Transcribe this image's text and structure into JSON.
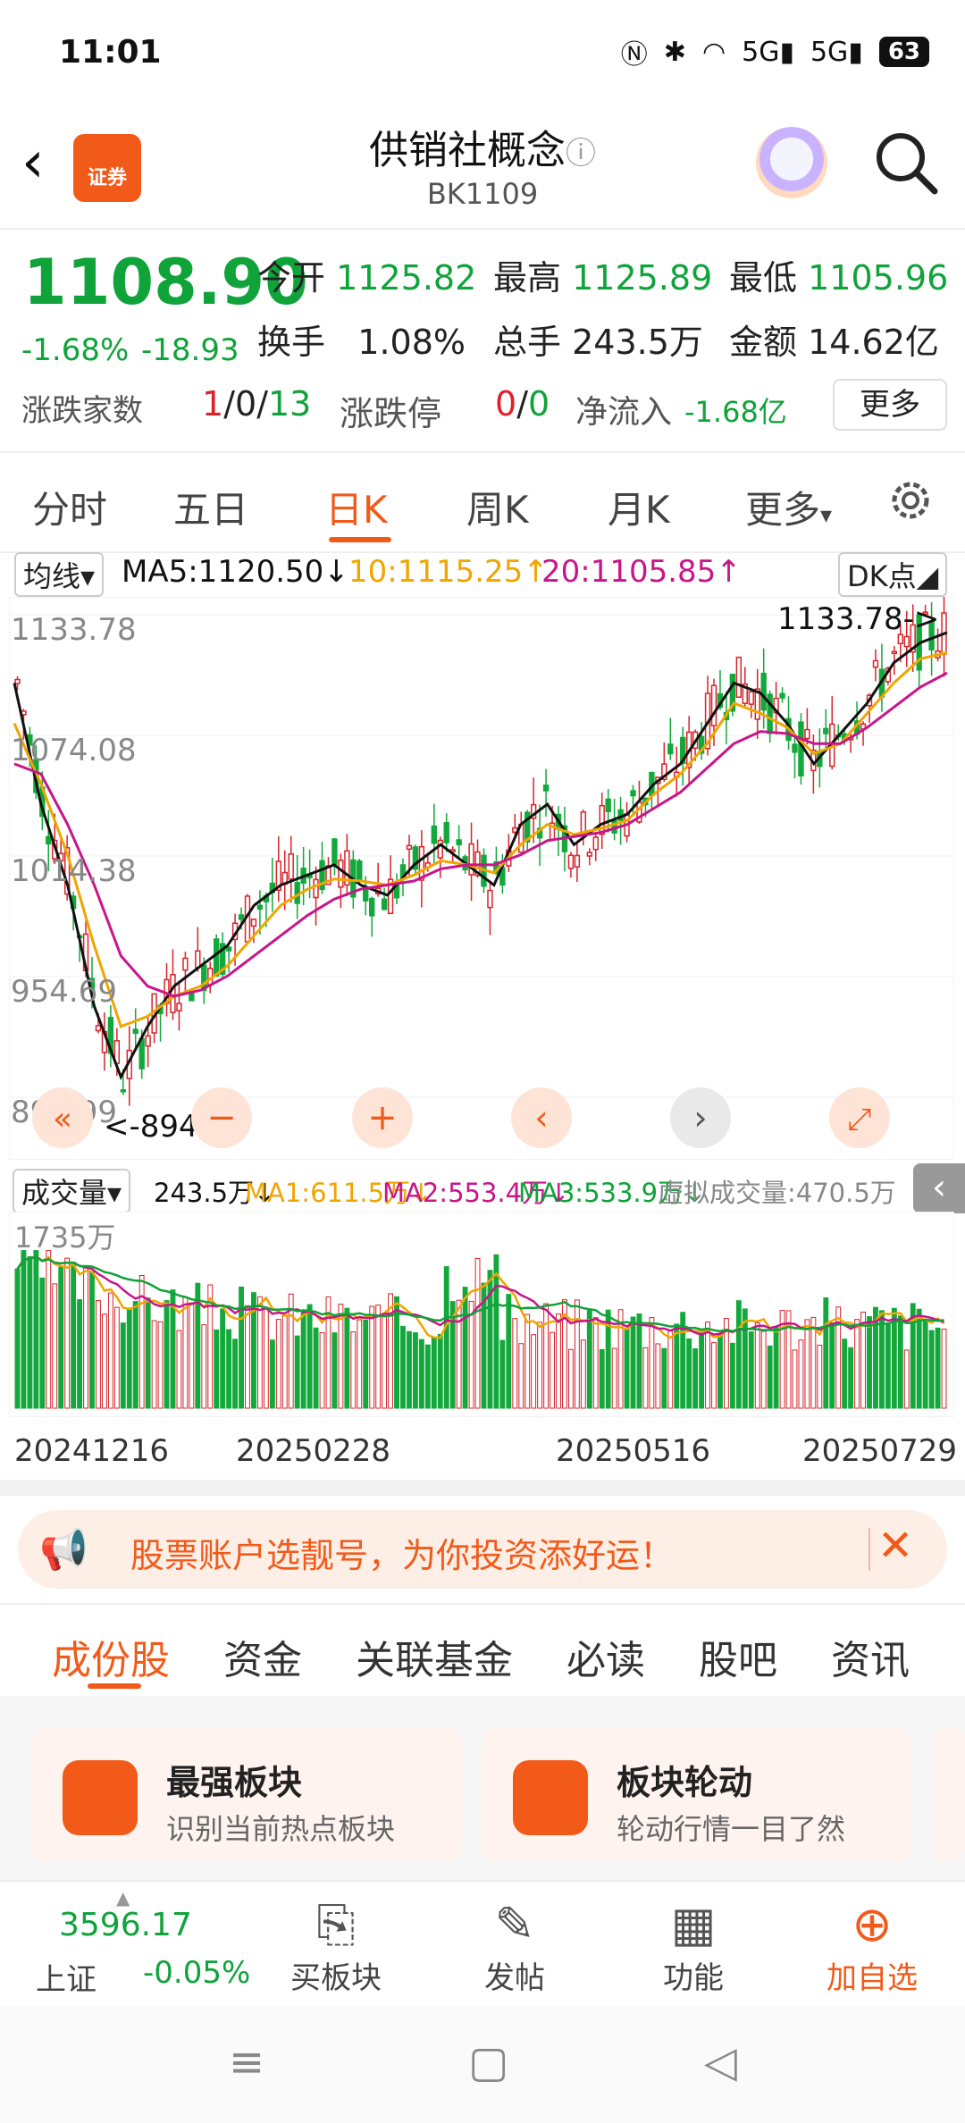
{
  "status": {
    "time": "11:01",
    "icons": [
      "nfc-icon",
      "bluetooth-icon",
      "wifi-icon",
      "5g-signal-icon",
      "5g-signal-icon"
    ],
    "battery": "63"
  },
  "header": {
    "badge": "证券",
    "title": "供销社概念",
    "title_info": "ⓘ",
    "code": "BK1109"
  },
  "quote": {
    "price": "1108.90",
    "change_pct": "-1.68%",
    "change_abs": "-18.93",
    "open_label": "今开",
    "open": "1125.82",
    "high_label": "最高",
    "high": "1125.89",
    "low_label": "最低",
    "low": "1105.96",
    "turnover_label": "换手",
    "turnover": "1.08%",
    "volume_label": "总手",
    "volume": "243.5万",
    "amount_label": "金额",
    "amount": "14.62亿",
    "updown_label": "涨跌家数",
    "up": "1",
    "flat": "0",
    "down": "13",
    "limit_label": "涨跌停",
    "limit_up": "0",
    "limit_down": "0",
    "netflow_label": "净流入",
    "netflow": "-1.68亿",
    "more": "更多"
  },
  "ktabs": {
    "items": [
      "分时",
      "五日",
      "日K",
      "周K",
      "月K",
      "更多"
    ],
    "active": "日K",
    "more_arrow": "▾"
  },
  "ma": {
    "selector": "均线▾",
    "ma5": "MA5:1120.50↓",
    "ma10": "10:1115.25↑",
    "ma20": "20:1105.85↑",
    "dk": "DK点◢",
    "colors": {
      "ma5": "#111111",
      "ma10": "#f0a500",
      "ma20": "#c8158a",
      "up": "#d8232a",
      "down": "#12a83b"
    }
  },
  "chart_data": {
    "type": "candlestick",
    "y_ticks": [
      "1133.78",
      "1074.08",
      "1014.38",
      "954.69",
      "894.99"
    ],
    "max_label": "1133.78->",
    "min_label": "<-894.99",
    "dates": [
      "20241216",
      "20250228",
      "20250516",
      "20250729"
    ],
    "ylim": [
      894.99,
      1133.78
    ],
    "ma5_path": [
      1100,
      1040,
      1000,
      940,
      905,
      930,
      950,
      960,
      970,
      990,
      1000,
      1005,
      1010,
      1000,
      995,
      1010,
      1020,
      1010,
      1000,
      1030,
      1040,
      1020,
      1030,
      1035,
      1050,
      1060,
      1080,
      1100,
      1095,
      1080,
      1060,
      1075,
      1090,
      1110,
      1120,
      1125
    ],
    "ma10_path": [
      1080,
      1050,
      1015,
      970,
      930,
      935,
      945,
      950,
      960,
      975,
      990,
      998,
      1003,
      1002,
      1000,
      1005,
      1012,
      1010,
      1006,
      1020,
      1030,
      1025,
      1028,
      1032,
      1045,
      1055,
      1070,
      1090,
      1085,
      1078,
      1065,
      1070,
      1085,
      1100,
      1112,
      1115
    ],
    "ma20_path": [
      1060,
      1055,
      1030,
      1000,
      965,
      950,
      945,
      948,
      955,
      965,
      975,
      985,
      993,
      998,
      1000,
      1002,
      1008,
      1010,
      1010,
      1015,
      1022,
      1024,
      1026,
      1030,
      1038,
      1046,
      1058,
      1070,
      1076,
      1075,
      1070,
      1070,
      1078,
      1088,
      1098,
      1105
    ]
  },
  "volume": {
    "selector": "成交量▾",
    "value": "243.5万↓",
    "ma1": "MA1:611.5万↓",
    "ma2": "MA2:553.4万↓",
    "ma3": "MA3:533.9万↓",
    "virtual": "虚拟成交量:470.5万",
    "top_label": "1735万"
  },
  "banner": {
    "text": "股票账户选靓号，为你投资添好运！"
  },
  "subtabs": {
    "items": [
      "成份股",
      "资金",
      "关联基金",
      "必读",
      "股吧",
      "资讯"
    ],
    "active": "成份股"
  },
  "cards": [
    {
      "title": "最强板块",
      "desc": "识别当前热点板块"
    },
    {
      "title": "板块轮动",
      "desc": "轮动行情一目了然"
    }
  ],
  "bottom": {
    "index_value": "3596.17",
    "index_name": "上证",
    "index_change": "-0.05%",
    "buy": "买板块",
    "post": "发帖",
    "func": "功能",
    "add": "加自选"
  }
}
